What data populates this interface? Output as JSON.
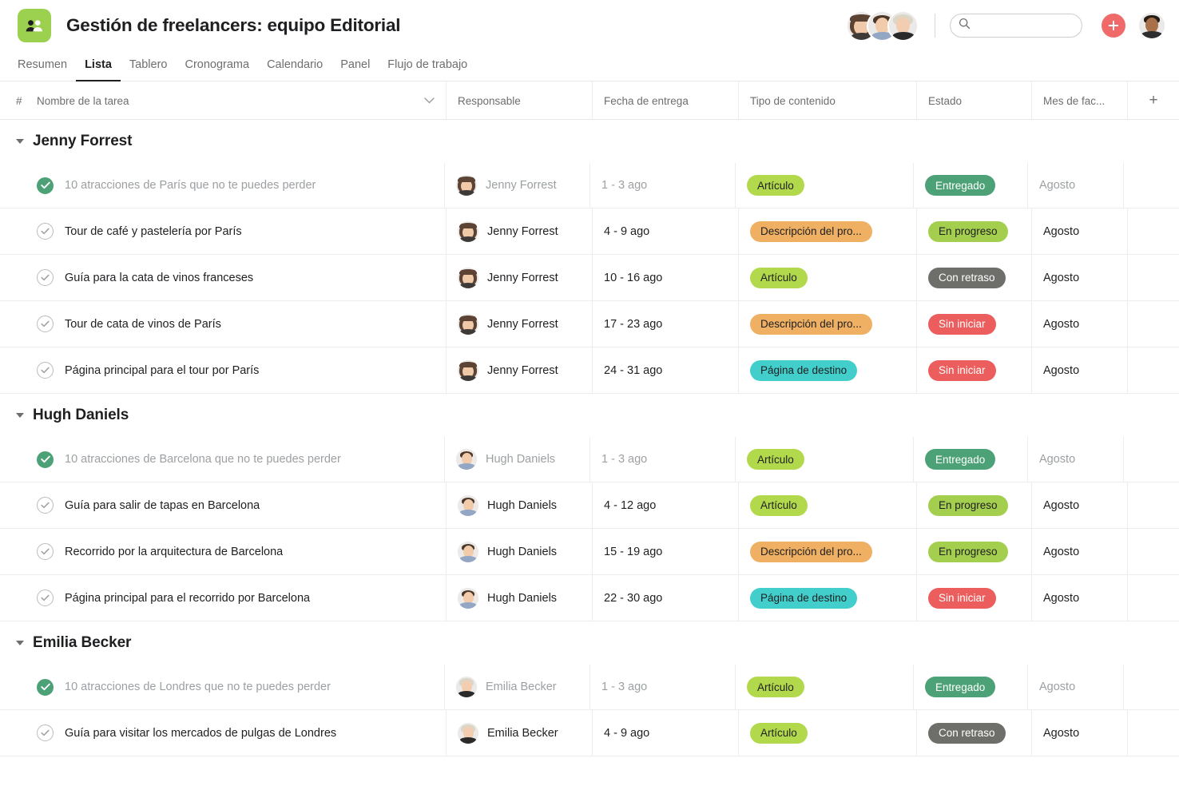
{
  "header": {
    "project_title": "Gestión de freelancers: equipo Editorial",
    "project_icon": "people-icon",
    "search_placeholder": "",
    "search_value": "",
    "add_label": "+",
    "colors": {
      "project_icon_bg": "#9BD14E",
      "add_button_bg": "#F06A6A",
      "active_tab": "#1e1f21"
    }
  },
  "tabs": [
    {
      "label": "Resumen",
      "active": false
    },
    {
      "label": "Lista",
      "active": true
    },
    {
      "label": "Tablero",
      "active": false
    },
    {
      "label": "Cronograma",
      "active": false
    },
    {
      "label": "Calendario",
      "active": false
    },
    {
      "label": "Panel",
      "active": false
    },
    {
      "label": "Flujo de trabajo",
      "active": false
    }
  ],
  "table": {
    "columns": {
      "num": "#",
      "task": "Nombre de la tarea",
      "assignee": "Responsable",
      "due": "Fecha de entrega",
      "type": "Tipo de contenido",
      "status": "Estado",
      "month": "Mes de fac...",
      "add": "+"
    },
    "groups": [
      {
        "name": "Jenny Forrest",
        "avatar": "jenny",
        "rows": [
          {
            "task": "10 atracciones de París que no te puedes perder",
            "assignee": "Jenny Forrest",
            "due": "1 - 3 ago",
            "type": "Artículo",
            "type_color": "#B2D94B",
            "status": "Entregado",
            "status_color": "#4CA176",
            "status_text": "#ffffff",
            "month": "Agosto",
            "done": true
          },
          {
            "task": "Tour de café y pastelería por París",
            "assignee": "Jenny Forrest",
            "due": "4 - 9 ago",
            "type": "Descripción del pro...",
            "type_color": "#EFB063",
            "status": "En progreso",
            "status_color": "#A4CE4E",
            "status_text": "#1e1f21",
            "month": "Agosto",
            "done": false
          },
          {
            "task": "Guía para la cata de vinos franceses",
            "assignee": "Jenny Forrest",
            "due": "10 - 16 ago",
            "type": "Artículo",
            "type_color": "#B2D94B",
            "status": "Con retraso",
            "status_color": "#6E6E6A",
            "status_text": "#ffffff",
            "month": "Agosto",
            "done": false
          },
          {
            "task": "Tour de cata de vinos de París",
            "assignee": "Jenny Forrest",
            "due": "17 - 23 ago",
            "type": "Descripción del pro...",
            "type_color": "#EFB063",
            "status": "Sin iniciar",
            "status_color": "#EC5D5D",
            "status_text": "#ffffff",
            "month": "Agosto",
            "done": false
          },
          {
            "task": "Página principal para el tour por París",
            "assignee": "Jenny Forrest",
            "due": "24 - 31 ago",
            "type": "Página de destino",
            "type_color": "#42CFCB",
            "status": "Sin iniciar",
            "status_color": "#EC5D5D",
            "status_text": "#ffffff",
            "month": "Agosto",
            "done": false
          }
        ]
      },
      {
        "name": "Hugh Daniels",
        "avatar": "hugh",
        "rows": [
          {
            "task": "10 atracciones de Barcelona que no te puedes perder",
            "assignee": "Hugh Daniels",
            "due": "1 - 3 ago",
            "type": "Artículo",
            "type_color": "#B2D94B",
            "status": "Entregado",
            "status_color": "#4CA176",
            "status_text": "#ffffff",
            "month": "Agosto",
            "done": true
          },
          {
            "task": "Guía para salir de tapas en Barcelona",
            "assignee": "Hugh Daniels",
            "due": "4 - 12 ago",
            "type": "Artículo",
            "type_color": "#B2D94B",
            "status": "En progreso",
            "status_color": "#A4CE4E",
            "status_text": "#1e1f21",
            "month": "Agosto",
            "done": false
          },
          {
            "task": "Recorrido por la arquitectura de Barcelona",
            "assignee": "Hugh Daniels",
            "due": "15 - 19 ago",
            "type": "Descripción del pro...",
            "type_color": "#EFB063",
            "status": "En progreso",
            "status_color": "#A4CE4E",
            "status_text": "#1e1f21",
            "month": "Agosto",
            "done": false
          },
          {
            "task": "Página principal para el recorrido por Barcelona",
            "assignee": "Hugh Daniels",
            "due": "22 - 30 ago",
            "type": "Página de destino",
            "type_color": "#42CFCB",
            "status": "Sin iniciar",
            "status_color": "#EC5D5D",
            "status_text": "#ffffff",
            "month": "Agosto",
            "done": false
          }
        ]
      },
      {
        "name": "Emilia Becker",
        "avatar": "emilia",
        "rows": [
          {
            "task": "10 atracciones de Londres que no te puedes perder",
            "assignee": "Emilia Becker",
            "due": "1 - 3 ago",
            "type": "Artículo",
            "type_color": "#B2D94B",
            "status": "Entregado",
            "status_color": "#4CA176",
            "status_text": "#ffffff",
            "month": "Agosto",
            "done": true
          },
          {
            "task": "Guía para visitar los mercados de pulgas de Londres",
            "assignee": "Emilia Becker",
            "due": "4 - 9 ago",
            "type": "Artículo",
            "type_color": "#B2D94B",
            "status": "Con retraso",
            "status_color": "#6E6E6A",
            "status_text": "#ffffff",
            "month": "Agosto",
            "done": false
          }
        ]
      }
    ]
  }
}
